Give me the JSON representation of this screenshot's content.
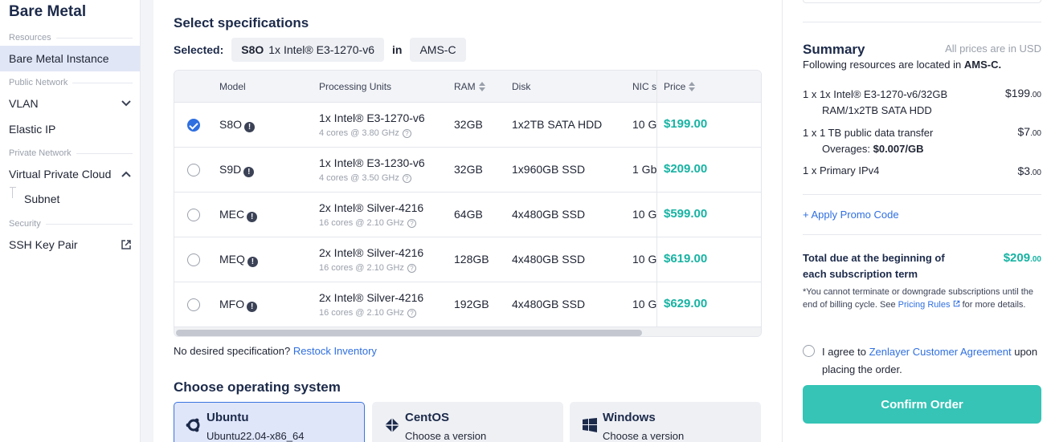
{
  "sidebar": {
    "title": "Bare Metal",
    "sections": {
      "resources": "Resources",
      "public_network": "Public Network",
      "private_network": "Private Network",
      "security": "Security"
    },
    "items": {
      "bare_metal_instance": "Bare Metal Instance",
      "vlan": "VLAN",
      "elastic_ip": "Elastic IP",
      "vpc": "Virtual Private Cloud",
      "subnet": "Subnet",
      "ssh_key_pair": "SSH Key Pair"
    }
  },
  "specs": {
    "heading": "Select specifications",
    "selected_label": "Selected:",
    "selected_model": "S8O",
    "selected_cpu": "1x Intel® E3-1270-v6",
    "in_label": "in",
    "selected_location": "AMS-C",
    "columns": {
      "model": "Model",
      "processing": "Processing Units",
      "ram": "RAM",
      "disk": "Disk",
      "nic": "NIC sp",
      "price": "Price"
    },
    "rows": [
      {
        "model": "S8O",
        "cpu": "1x Intel® E3-1270-v6",
        "cores": "4 cores @ 3.80 GHz",
        "ram": "32GB",
        "disk": "1x2TB SATA HDD",
        "nic": "10 G",
        "price": "$199.00",
        "selected": true
      },
      {
        "model": "S9D",
        "cpu": "1x Intel® E3-1230-v6",
        "cores": "4 cores @ 3.50 GHz",
        "ram": "32GB",
        "disk": "1x960GB SSD",
        "nic": "1 Gb",
        "price": "$209.00",
        "selected": false
      },
      {
        "model": "MEC",
        "cpu": "2x Intel® Silver-4216",
        "cores": "16 cores @ 2.10 GHz",
        "ram": "64GB",
        "disk": "4x480GB SSD",
        "nic": "10 G",
        "price": "$599.00",
        "selected": false
      },
      {
        "model": "MEQ",
        "cpu": "2x Intel® Silver-4216",
        "cores": "16 cores @ 2.10 GHz",
        "ram": "128GB",
        "disk": "4x480GB SSD",
        "nic": "10 G",
        "price": "$619.00",
        "selected": false
      },
      {
        "model": "MFO",
        "cpu": "2x Intel® Silver-4216",
        "cores": "16 cores @ 2.10 GHz",
        "ram": "192GB",
        "disk": "4x480GB SSD",
        "nic": "10 G",
        "price": "$629.00",
        "selected": false
      }
    ],
    "no_desired": "No desired specification?",
    "restock_link": "Restock Inventory"
  },
  "os": {
    "heading": "Choose operating system",
    "options": [
      {
        "name": "Ubuntu",
        "version": "Ubuntu22.04-x86_64",
        "selected": true
      },
      {
        "name": "CentOS",
        "version": "Choose a version",
        "selected": false
      },
      {
        "name": "Windows",
        "version": "Choose a version",
        "selected": false
      }
    ]
  },
  "summary": {
    "title": "Summary",
    "note": "All prices are in USD",
    "location_prefix": "Following resources are located in",
    "location": "AMS-C.",
    "line1_a": "1 x 1x Intel® E3-1270-v6/32GB",
    "line1_b": "RAM/1x2TB SATA HDD",
    "line1_amt_main": "$199",
    "line1_amt_cents": ".00",
    "line2": "1 x 1 TB public data transfer",
    "line2_amt_main": "$7",
    "line2_amt_cents": ".00",
    "overages_label": "Overages:",
    "overages_value": "$0.007/GB",
    "line3": "1 x Primary IPv4",
    "line3_amt_main": "$3",
    "line3_amt_cents": ".00",
    "promo": "+ Apply Promo Code",
    "total_label": "Total due at the beginning of each subscription term",
    "total_main": "$209",
    "total_cents": ".00",
    "fine_a": "*You cannot terminate or downgrade subscriptions until the end of billing cycle. See",
    "fine_link": "Pricing Rules",
    "fine_b": "for more details.",
    "agree_prefix": "I agree to",
    "agree_link": "Zenlayer Customer Agreement",
    "agree_suffix": "upon placing the order.",
    "confirm": "Confirm Order"
  },
  "colors": {
    "accent_teal": "#17b3a3",
    "confirm_teal": "#35c4b6",
    "link_blue": "#2f6fe0",
    "active_bg": "#e1e6f6"
  }
}
